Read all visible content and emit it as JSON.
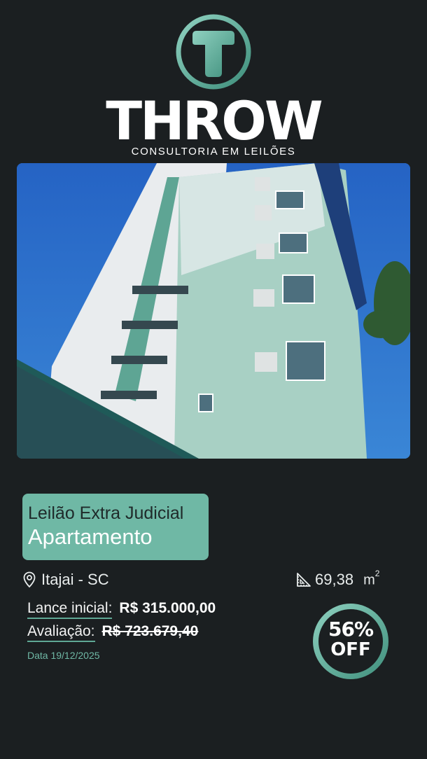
{
  "brand": {
    "name": "THROW",
    "subtitle": "CONSULTORIA EM LEILÕES",
    "accent": "#6fb8a5",
    "icon": "t-logo-icon"
  },
  "listing": {
    "type_line1": "Leilão Extra Judicial",
    "type_line2": "Apartamento",
    "location": "Itajai - SC",
    "location_icon": "map-pin-icon",
    "area": "69,38",
    "area_unit": "m",
    "area_unit_sup": "2",
    "area_icon": "ruler-triangle-icon",
    "initial_bid_label": "Lance inicial:",
    "initial_bid_value": "R$ 315.000,00",
    "appraisal_label": "Avaliação:",
    "appraisal_value": "R$ 723.679,40",
    "date": "Data 19/12/2025",
    "discount_pct": "56%",
    "discount_off": "OFF"
  },
  "colors": {
    "background": "#1b1f21",
    "box": "#6fb8a5",
    "box_text": "#1f2a2a"
  }
}
